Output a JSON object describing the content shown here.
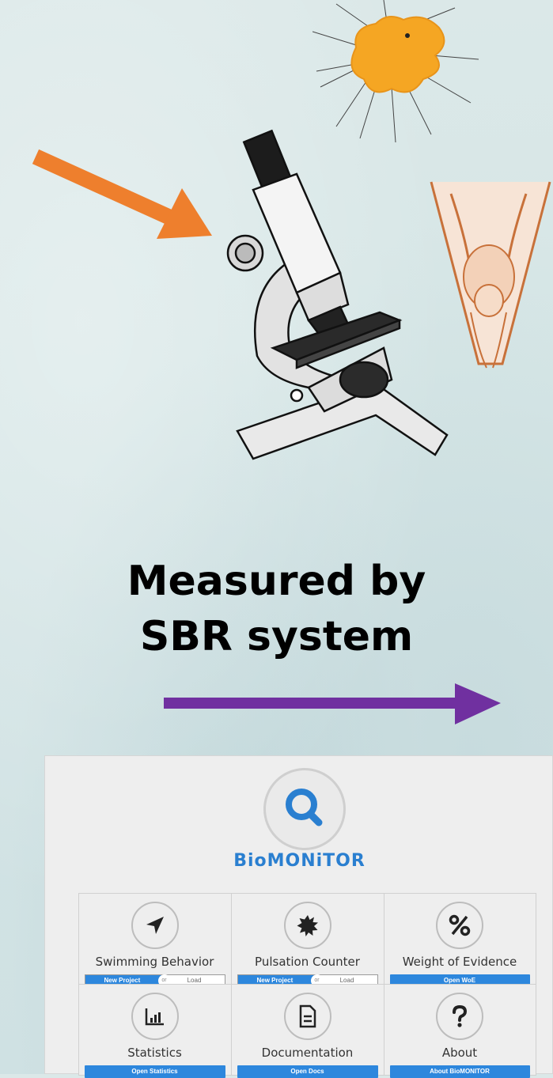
{
  "caption": {
    "line1": "Measured  by",
    "line2": "SBR system"
  },
  "colors": {
    "orange_arrow": "#ee7f2d",
    "purple_arrow": "#7030a0",
    "brand_blue": "#2a7fd0",
    "button_blue": "#2d87dd"
  },
  "app": {
    "logo_icon": "search-icon",
    "brand_name": "BioMONiTOR",
    "cards": [
      {
        "title": "Swimming Behavior",
        "icon": "navigation-arrow-icon",
        "primary": "New Project",
        "or": "or",
        "secondary": "Load"
      },
      {
        "title": "Pulsation Counter",
        "icon": "starburst-icon",
        "primary": "New Project",
        "or": "or",
        "secondary": "Load"
      },
      {
        "title": "Weight of Evidence",
        "icon": "percent-icon",
        "primary": "Open WoE"
      },
      {
        "title": "Statistics",
        "icon": "bar-chart-icon",
        "primary": "Open Statistics"
      },
      {
        "title": "Documentation",
        "icon": "document-icon",
        "primary": "Open Docs"
      },
      {
        "title": "About",
        "icon": "question-icon",
        "primary": "About BioMONITOR"
      }
    ]
  }
}
